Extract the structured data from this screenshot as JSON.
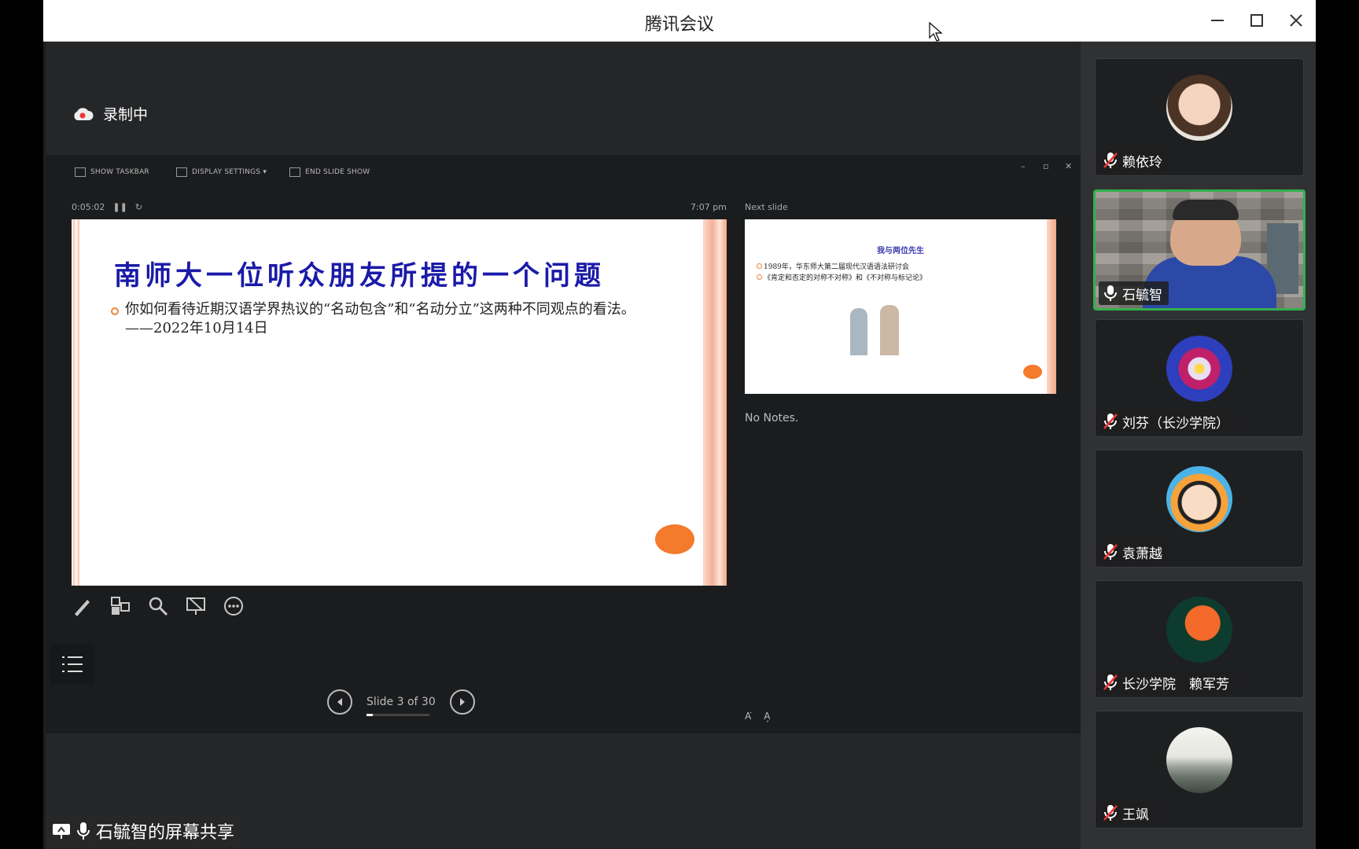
{
  "window": {
    "title": "腾讯会议"
  },
  "recording": {
    "label": "录制中"
  },
  "presenter": {
    "toolbar": {
      "show_taskbar": "SHOW TASKBAR",
      "display_settings": "DISPLAY SETTINGS ▾",
      "end_slide_show": "END SLIDE SHOW"
    },
    "elapsed": "0:05:02",
    "clock": "7:07 pm",
    "next_slide_label": "Next slide",
    "current_slide": {
      "title": "南师大一位听众朋友所提的一个问题",
      "body": "你如何看待近期汉语学界热议的“名动包含”和“名动分立”这两种不同观点的看法。　　　　　　——2022年10月14日"
    },
    "next_slide": {
      "title": "我与两位先生",
      "lines": [
        "1989年，华东师大第二届现代汉语语法研讨会",
        "《肯定和否定的对称不对称》和《不对称与标记论》"
      ]
    },
    "notes": "No Notes.",
    "slide_counter": "Slide 3 of 30",
    "progress": 0.1
  },
  "share": {
    "label": "石毓智的屏幕共享"
  },
  "participants": [
    {
      "name": "赖依玲",
      "muted": true,
      "type": "avatar-girl"
    },
    {
      "name": "石毓智",
      "muted": false,
      "type": "video",
      "active": true
    },
    {
      "name": "刘芬（长沙学院）",
      "muted": true,
      "type": "avatar-flower"
    },
    {
      "name": "袁萧越",
      "muted": true,
      "type": "avatar-cartoon"
    },
    {
      "name": "长沙学院　赖军芳",
      "muted": true,
      "type": "avatar-gramophone"
    },
    {
      "name": "王飒",
      "muted": true,
      "type": "avatar-mountain"
    }
  ],
  "colors": {
    "active_border": "#34b04f",
    "slide_title": "#1a1aa8",
    "accent_orange": "#f47a2c"
  }
}
